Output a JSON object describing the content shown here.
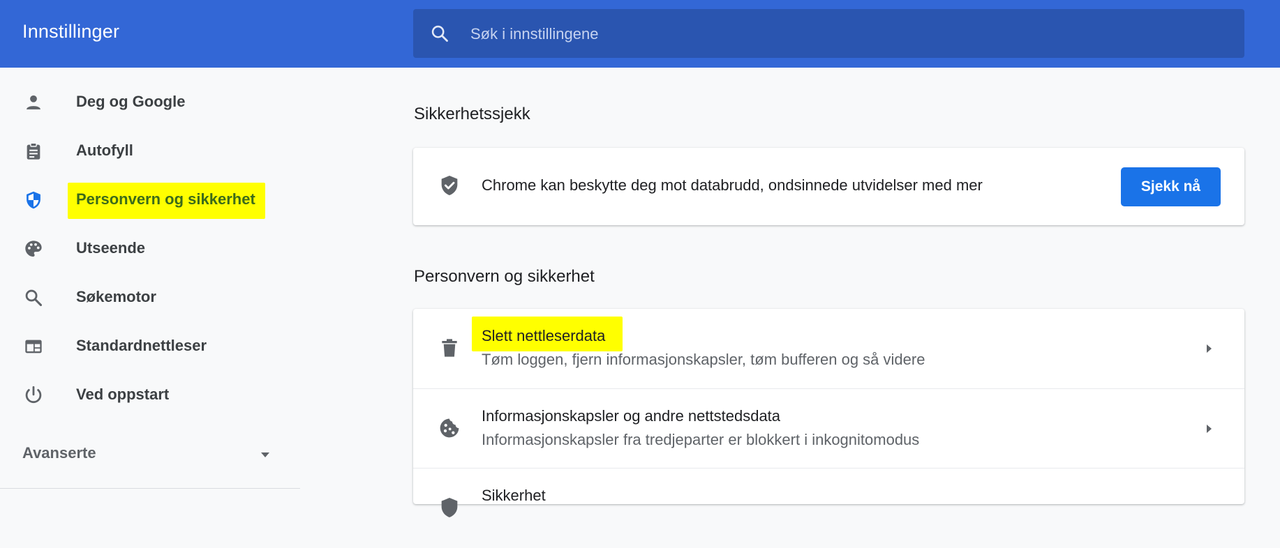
{
  "app": {
    "title": "Innstillinger"
  },
  "search": {
    "placeholder": "Søk i innstillingene"
  },
  "sidebar": {
    "items": [
      {
        "label": "Deg og Google",
        "icon": "person-icon"
      },
      {
        "label": "Autofyll",
        "icon": "clipboard-icon"
      },
      {
        "label": "Personvern og sikkerhet",
        "icon": "shield-icon",
        "active": true,
        "highlighted": true
      },
      {
        "label": "Utseende",
        "icon": "palette-icon"
      },
      {
        "label": "Søkemotor",
        "icon": "search-icon"
      },
      {
        "label": "Standardnettleser",
        "icon": "browser-icon"
      },
      {
        "label": "Ved oppstart",
        "icon": "power-icon"
      }
    ],
    "advanced_label": "Avanserte"
  },
  "safety_check": {
    "section_title": "Sikkerhetssjekk",
    "text": "Chrome kan beskytte deg mot databrudd, ondsinnede utvidelser med mer",
    "button_label": "Sjekk nå"
  },
  "privacy": {
    "section_title": "Personvern og sikkerhet",
    "rows": [
      {
        "title": "Slett nettleserdata",
        "subtitle": "Tøm loggen, fjern informasjonskapsler, tøm bufferen og så videre",
        "icon": "trash-icon",
        "highlighted": true
      },
      {
        "title": "Informasjonskapsler og andre nettstedsdata",
        "subtitle": "Informasjonskapsler fra tredjeparter er blokkert i inkognitomodus",
        "icon": "cookie-icon"
      },
      {
        "title": "Sikkerhet",
        "icon": "shield-icon"
      }
    ]
  },
  "colors": {
    "header": "#3367d6",
    "search_bg": "#2a55b0",
    "accent": "#1a73e8",
    "highlight": "#ffff00",
    "page_bg": "#f8f9fa"
  }
}
